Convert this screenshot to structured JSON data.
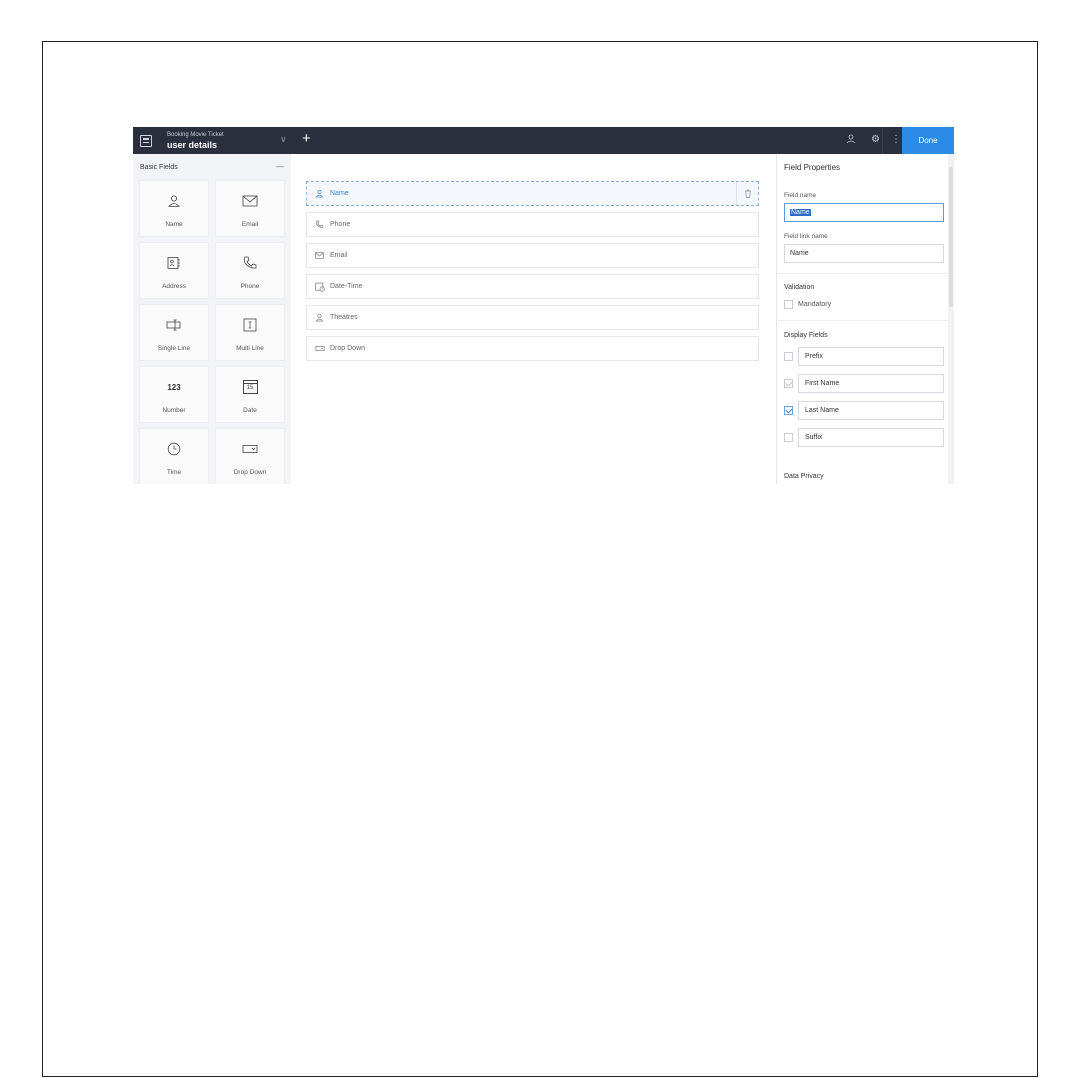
{
  "header": {
    "app_subtitle": "Booking Movie Ticket",
    "form_title": "user details",
    "done_label": "Done"
  },
  "left_panel": {
    "heading": "Basic Fields",
    "tiles": [
      {
        "label": "Name",
        "icon": "user-icon"
      },
      {
        "label": "Email",
        "icon": "envelope-icon"
      },
      {
        "label": "Address",
        "icon": "address-card-icon"
      },
      {
        "label": "Phone",
        "icon": "phone-icon"
      },
      {
        "label": "Single Line",
        "icon": "single-line-icon"
      },
      {
        "label": "Multi Line",
        "icon": "multi-line-icon"
      },
      {
        "label": "Number",
        "icon": "number-icon",
        "glyph": "123"
      },
      {
        "label": "Date",
        "icon": "calendar-icon",
        "glyph": "15"
      },
      {
        "label": "Time",
        "icon": "clock-icon"
      },
      {
        "label": "Drop Down",
        "icon": "dropdown-icon"
      }
    ]
  },
  "form_fields": [
    {
      "label": "Name",
      "icon": "user-icon",
      "selected": true
    },
    {
      "label": "Phone",
      "icon": "phone-icon"
    },
    {
      "label": "Email",
      "icon": "envelope-icon"
    },
    {
      "label": "Date-Time",
      "icon": "datetime-icon"
    },
    {
      "label": "Theatres",
      "icon": "user-icon"
    },
    {
      "label": "Drop Down",
      "icon": "dropdown-icon"
    }
  ],
  "properties": {
    "heading": "Field Properties",
    "field_name_label": "Field name",
    "field_name_value": "Name",
    "field_link_label": "Field link name",
    "field_link_value": "Name",
    "validation_heading": "Validation",
    "mandatory_label": "Mandatory",
    "display_fields_heading": "Display Fields",
    "display_fields": [
      {
        "label": "Prefix",
        "checked": false
      },
      {
        "label": "First Name",
        "checked": true,
        "disabled": true
      },
      {
        "label": "Last Name",
        "checked": true
      },
      {
        "label": "Suffix",
        "checked": false
      }
    ],
    "data_privacy_heading": "Data Privacy"
  },
  "colors": {
    "topbar": "#2a2f3d",
    "accent": "#2b8be6",
    "selected_field": "#3a86d0"
  }
}
